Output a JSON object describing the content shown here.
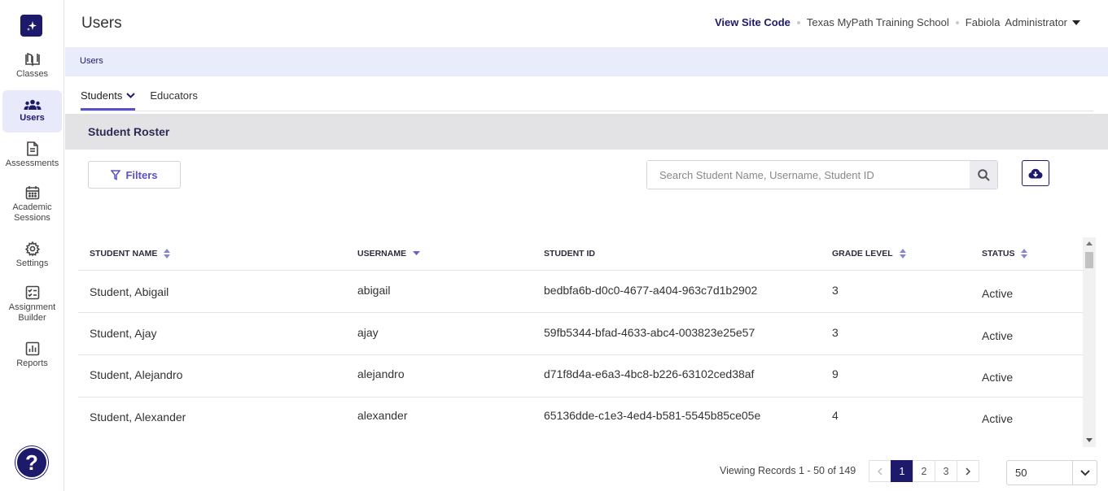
{
  "sidebar": {
    "items": [
      {
        "label": "Classes",
        "icon": "book-icon"
      },
      {
        "label": "Users",
        "icon": "users-icon"
      },
      {
        "label": "Assessments",
        "icon": "document-icon"
      },
      {
        "label": "Academic Sessions",
        "icon": "calendar-icon"
      },
      {
        "label": "Settings",
        "icon": "gear-icon"
      },
      {
        "label": "Assignment Builder",
        "icon": "checklist-icon"
      },
      {
        "label": "Reports",
        "icon": "bar-chart-icon"
      }
    ],
    "help_label": "?"
  },
  "header": {
    "title": "Users",
    "view_site_code": "View Site Code",
    "school": "Texas MyPath Training School",
    "user_name": "Fabiola",
    "user_role": "Administrator"
  },
  "breadcrumb": "Users",
  "tabs": [
    {
      "label": "Students",
      "active": true
    },
    {
      "label": "Educators",
      "active": false
    }
  ],
  "roster_title": "Student Roster",
  "filters_label": "Filters",
  "search": {
    "placeholder": "Search Student Name, Username, Student ID",
    "value": ""
  },
  "table": {
    "headers": [
      "STUDENT NAME",
      "USERNAME",
      "STUDENT ID",
      "GRADE LEVEL",
      "STATUS"
    ],
    "rows": [
      {
        "name": "Student, Abigail",
        "username": "abigail",
        "student_id": "bedbfa6b-d0c0-4677-a404-963c7d1b2902",
        "grade": "3",
        "status": "Active"
      },
      {
        "name": "Student, Ajay",
        "username": "ajay",
        "student_id": "59fb5344-bfad-4633-abc4-003823e25e57",
        "grade": "3",
        "status": "Active"
      },
      {
        "name": "Student, Alejandro",
        "username": "alejandro",
        "student_id": "d71f8d4a-e6a3-4bc8-b226-63102ced38af",
        "grade": "9",
        "status": "Active"
      },
      {
        "name": "Student, Alexander",
        "username": "alexander",
        "student_id": "65136dde-c1e3-4ed4-b581-5545b85ce05e",
        "grade": "4",
        "status": "Active"
      }
    ]
  },
  "pagination": {
    "records_text": "Viewing Records 1 - 50 of 149",
    "pages": [
      "1",
      "2",
      "3"
    ],
    "current_page": "1",
    "per_page": "50"
  },
  "colors": {
    "brand": "#1d1a6b",
    "accent": "#5a4fc8",
    "breadcrumb_bg": "#e8ecfb"
  }
}
